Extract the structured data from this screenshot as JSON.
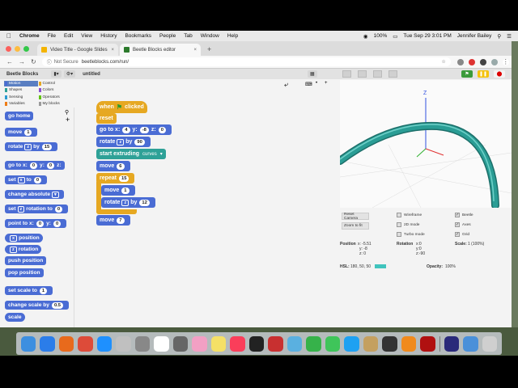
{
  "menubar": {
    "app_name": "Chrome",
    "items": [
      "File",
      "Edit",
      "View",
      "History",
      "Bookmarks",
      "People",
      "Tab",
      "Window",
      "Help"
    ],
    "battery": "100%",
    "datetime": "Tue Sep 29  3:01 PM",
    "user": "Jennifer Bailey"
  },
  "browser": {
    "tabs": [
      {
        "title": "Video Title - Google Slides",
        "icon_color": "#f4b400"
      },
      {
        "title": "Beetle Blocks editor",
        "icon_color": "#2c7a2c"
      }
    ],
    "not_secure": "Not Secure",
    "url": "beetleblocks.com/run/"
  },
  "editor": {
    "logo": "Beetle Blocks",
    "project_name": "untitled",
    "categories": [
      {
        "label": "Motion",
        "color": "#4a6cd4"
      },
      {
        "label": "Control",
        "color": "#e6a822"
      },
      {
        "label": "Shapes",
        "color": "#2ea197"
      },
      {
        "label": "Colors",
        "color": "#8a4fd0"
      },
      {
        "label": "Sensing",
        "color": "#2c9ad0"
      },
      {
        "label": "Operators",
        "color": "#62c213"
      },
      {
        "label": "Variables",
        "color": "#ee7d16"
      },
      {
        "label": "My blocks",
        "color": "#9a9a9a"
      }
    ],
    "palette": {
      "go_home": "go home",
      "move": "move",
      "move_val": "1",
      "rotate": "rotate",
      "rotate_axis": "z",
      "rotate_by": "by",
      "rotate_val": "15",
      "goto": "go to x:",
      "goto_x": "0",
      "goto_y_lbl": "y:",
      "goto_y": "0",
      "goto_z_lbl": "z:",
      "set": "set",
      "set_axis": "x",
      "set_to": "to",
      "set_val": "0",
      "change_abs": "change absolute",
      "set_rot": "set",
      "set_rot_axis": "z",
      "set_rot_lbl": "rotation to",
      "set_rot_val": "0",
      "point": "point to x:",
      "point_x": "0",
      "point_y_lbl": "y:",
      "point_y": "0",
      "pos_axis": "x",
      "position": "position",
      "rot_axis": "z",
      "rotation": "rotation",
      "push": "push position",
      "pop": "pop position",
      "set_scale": "set scale to",
      "set_scale_val": "1",
      "change_scale": "change scale by",
      "change_scale_val": "0.5",
      "scale": "scale"
    },
    "script": {
      "when": "when",
      "clicked": "clicked",
      "reset": "reset",
      "goto": "go to x:",
      "goto_x": "4",
      "goto_y_lbl": "y:",
      "goto_y": "-8",
      "goto_z_lbl": "z:",
      "goto_z": "0",
      "rotate": "rotate",
      "rotate_axis": "z",
      "rotate_by": "by",
      "rotate_val": "90",
      "extrude": "start extruding",
      "extrude_mode": "curves",
      "move1": "move",
      "move1_val": "6",
      "repeat": "repeat",
      "repeat_val": "15",
      "move2": "move",
      "move2_val": "1",
      "rotate2": "rotate",
      "rotate2_axis": "z",
      "rotate2_by": "by",
      "rotate2_val": "12",
      "move3": "move",
      "move3_val": "7"
    },
    "stage": {
      "axis_label": "Z",
      "tube_color": "#2a9d95"
    },
    "controls": {
      "reset_camera": "Reset Camera",
      "zoom_fit": "Zoom to fit",
      "wireframe": "Wireframe",
      "mode2d": "2D mode",
      "turbo": "Turbo mode",
      "beetle": "Beetle",
      "axes": "Axes",
      "grid": "Grid",
      "position_lbl": "Position",
      "pos_x": "x: -5.51",
      "pos_y": "y: -8",
      "pos_z": "z: 0",
      "rotation_lbl": "Rotation",
      "rot_x": "x:0",
      "rot_y": "y:0",
      "rot_z": "z:-90",
      "scale_lbl": "Scale:",
      "scale_val": "1 (100%)",
      "hsl_lbl": "HSL:",
      "hsl_val": "180, 50, 50",
      "opacity_lbl": "Opacity:",
      "opacity_val": "100%"
    }
  },
  "dock": {
    "icons": [
      "finder-icon",
      "safari-icon",
      "firefox-icon",
      "chrome-icon",
      "messenger-icon",
      "launchpad-icon",
      "system-prefs-icon",
      "calendar-icon",
      "rocket-icon",
      "photos-icon",
      "notes-icon",
      "music-icon",
      "github-icon",
      "photo-booth-icon",
      "preview-icon",
      "numbers-icon",
      "facetime-icon",
      "appstore-icon",
      "folder-icon",
      "terminal-icon",
      "vlc-icon",
      "acrobat-icon",
      "audacity-icon",
      "downloads-icon",
      "trash-icon"
    ],
    "colors": [
      "#3d8fe0",
      "#2b7de9",
      "#e86a1c",
      "#dd4b39",
      "#1e90ff",
      "#c0c0c0",
      "#888888",
      "#ffffff",
      "#666666",
      "#f2a0c4",
      "#f5e066",
      "#fa3e5a",
      "#222222",
      "#c83030",
      "#5ab0e0",
      "#36b24a",
      "#3fc55a",
      "#1da1f2",
      "#c4a060",
      "#333333",
      "#f08a1c",
      "#b01010",
      "#2a2a7a",
      "#4a90d9",
      "#cfcfcf"
    ]
  }
}
